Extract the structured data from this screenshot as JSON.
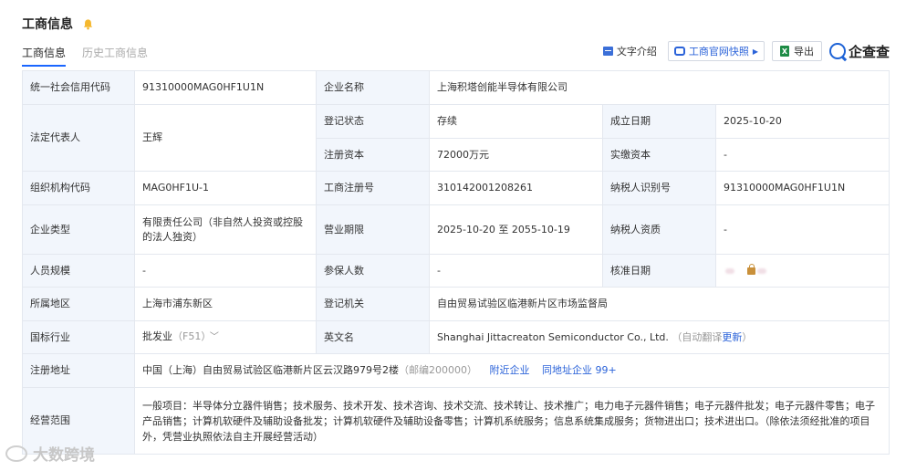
{
  "header": {
    "title": "工商信息"
  },
  "tabs": [
    {
      "label": "工商信息",
      "active": true
    },
    {
      "label": "历史工商信息",
      "active": false
    }
  ],
  "toolbar": {
    "text_intro": "文字介绍",
    "official_snapshot": "工商官网快照",
    "export": "导出",
    "brand": "企查查"
  },
  "rows": {
    "credit_code_label": "统一社会信用代码",
    "credit_code": "91310000MAG0HF1U1N",
    "company_name_label": "企业名称",
    "company_name": "上海积塔创能半导体有限公司",
    "legal_rep_label": "法定代表人",
    "legal_rep": "王辉",
    "reg_status_label": "登记状态",
    "reg_status": "存续",
    "established_label": "成立日期",
    "established": "2025-10-20",
    "reg_capital_label": "注册资本",
    "reg_capital": "72000万元",
    "paid_capital_label": "实缴资本",
    "paid_capital": "-",
    "org_code_label": "组织机构代码",
    "org_code": "MAG0HF1U-1",
    "biz_reg_no_label": "工商注册号",
    "biz_reg_no": "310142001208261",
    "taxpayer_id_label": "纳税人识别号",
    "taxpayer_id": "91310000MAG0HF1U1N",
    "company_type_label": "企业类型",
    "company_type": "有限责任公司（非自然人投资或控股的法人独资）",
    "biz_term_label": "营业期限",
    "biz_term": "2025-10-20 至 2055-10-19",
    "taxpayer_qual_label": "纳税人资质",
    "taxpayer_qual": "-",
    "staff_size_label": "人员规模",
    "staff_size": "-",
    "insured_label": "参保人数",
    "insured": "-",
    "approval_date_label": "核准日期",
    "region_label": "所属地区",
    "region": "上海市浦东新区",
    "reg_authority_label": "登记机关",
    "reg_authority": "自由贸易试验区临港新片区市场监督局",
    "industry_label": "国标行业",
    "industry": "批发业",
    "industry_code": "（F51）",
    "english_name_label": "英文名",
    "english_name": "Shanghai Jittacreaton Semiconductor Co., Ltd.",
    "auto_translate": "（自动翻译",
    "update": "更新",
    "auto_translate_close": "）",
    "address_label": "注册地址",
    "address": "中国（上海）自由贸易试验区临港新片区云汉路979号2楼",
    "postcode": "（邮编200000）",
    "nearby": "附近企业",
    "same_address": "同地址企业 99+",
    "scope_label": "经营范围",
    "scope": "一般项目：半导体分立器件销售；技术服务、技术开发、技术咨询、技术交流、技术转让、技术推广；电力电子元器件销售；电子元器件批发；电子元器件零售；电子产品销售；计算机软硬件及辅助设备批发；计算机软硬件及辅助设备零售；计算机系统服务；信息系统集成服务；货物进出口；技术进出口。（除依法须经批准的项目外，凭营业执照依法自主开展经营活动）"
  },
  "watermark": "大数跨境",
  "colors": {
    "accent": "#2b63d9",
    "label_bg": "#f2f6fc",
    "border": "#e4e8ef"
  }
}
